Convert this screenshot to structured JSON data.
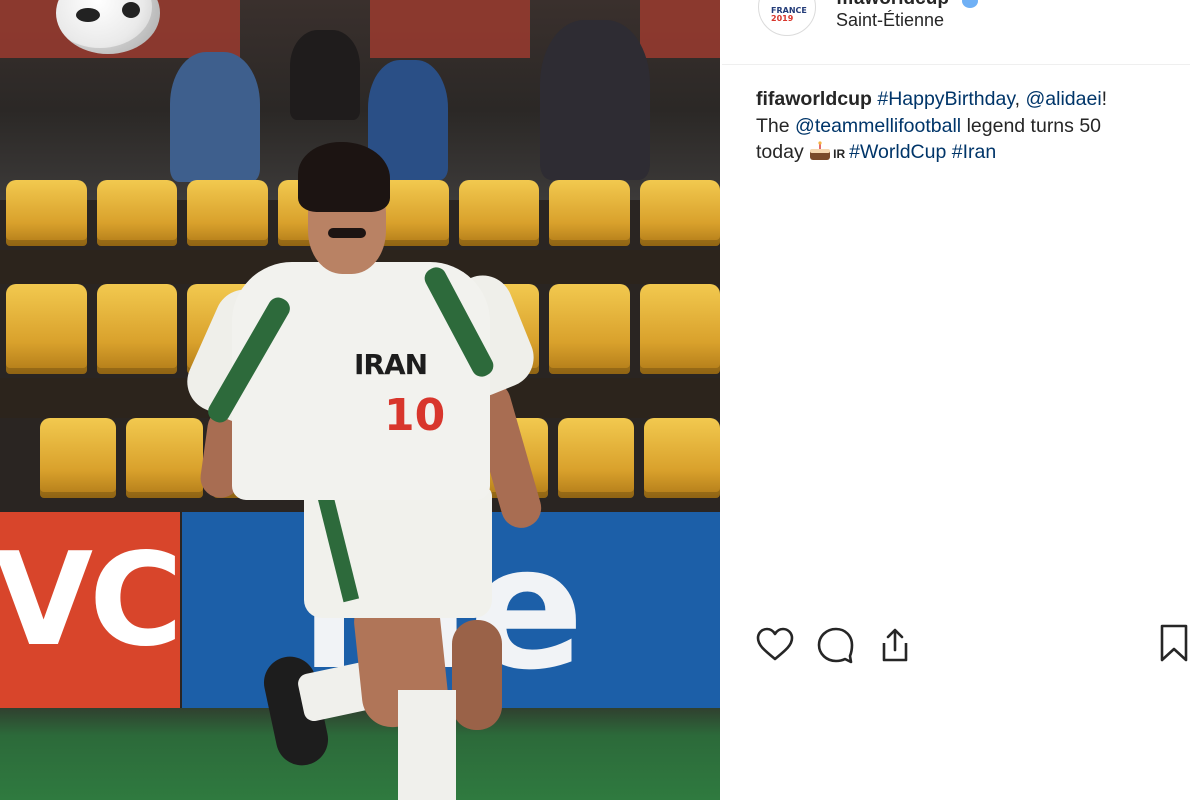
{
  "post": {
    "account": {
      "username": "fifaworldcup",
      "location": "Saint-Étienne",
      "avatar_text_line1": "FRANCE",
      "avatar_text_line2": "2019"
    },
    "caption": {
      "username": "fifaworldcup",
      "hashtag_birthday": "#HappyBirthday",
      "comma": ",",
      "mention_player": "@alidaei",
      "exclaim": "!",
      "the": "The",
      "mention_team": "@teammellifootball",
      "legend_text": "legend turns 50",
      "today": "today",
      "flag_code": "IR",
      "hashtag_worldcup": "#WorldCup",
      "hashtag_iran": "#Iran"
    },
    "photo": {
      "jersey_text": "IRAN",
      "jersey_number": "10",
      "board_left": "VC",
      "board_right": "ille"
    },
    "actions": {
      "like_icon": "heart-icon",
      "comment_icon": "comment-icon",
      "share_icon": "share-icon",
      "save_icon": "bookmark-icon"
    },
    "colors": {
      "link": "#003569",
      "text": "#262626",
      "divider": "#efefef"
    }
  }
}
